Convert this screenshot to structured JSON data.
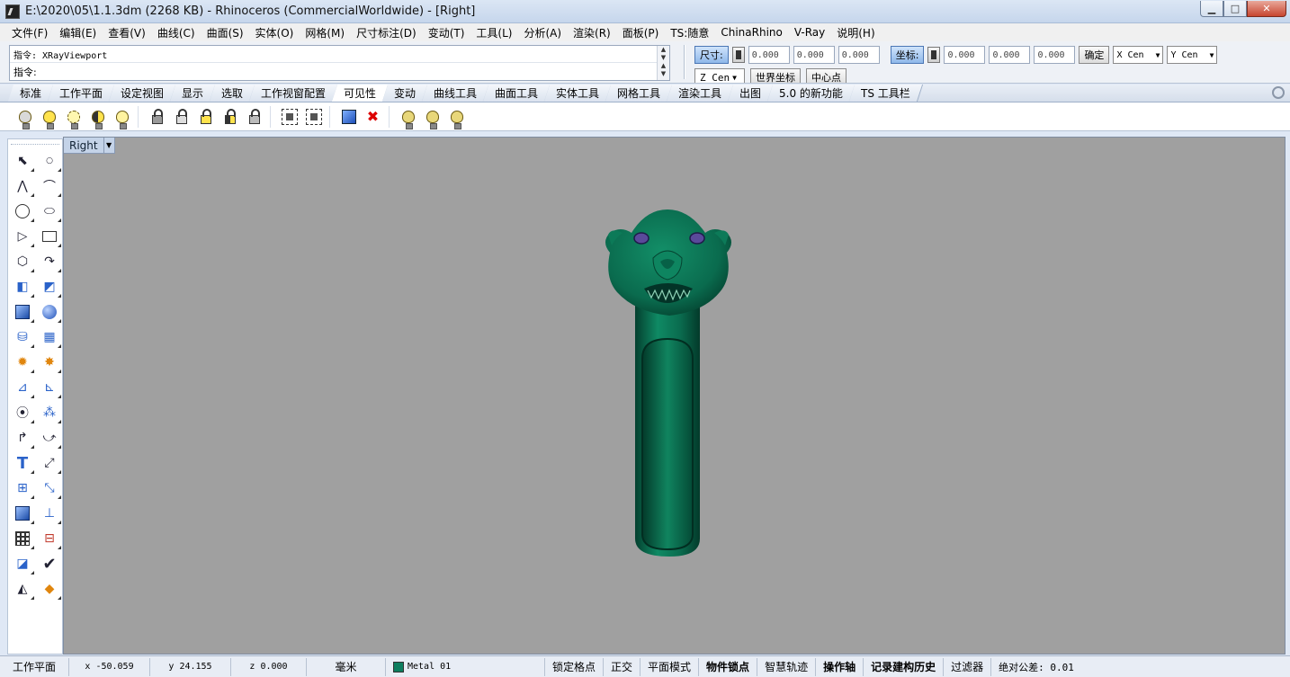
{
  "window": {
    "title": "E:\\2020\\05\\1.1.3dm (2268 KB) - Rhinoceros (CommercialWorldwide) - [Right]",
    "min_label": "▁",
    "max_label": "□",
    "close_label": "✕"
  },
  "menu": {
    "items": [
      "文件(F)",
      "编辑(E)",
      "查看(V)",
      "曲线(C)",
      "曲面(S)",
      "实体(O)",
      "网格(M)",
      "尺寸标注(D)",
      "变动(T)",
      "工具(L)",
      "分析(A)",
      "渲染(R)",
      "面板(P)",
      "TS:随意",
      "ChinaRhino",
      "V-Ray",
      "说明(H)"
    ]
  },
  "command": {
    "history": "指令: XRayViewport",
    "prompt": "指令:"
  },
  "dimensions": {
    "size_label": "尺寸:",
    "size_values": [
      "0.000",
      "0.000",
      "0.000"
    ],
    "coord_label": "坐标:",
    "coord_values": [
      "0.000",
      "0.000",
      "0.000"
    ],
    "confirm_label": "确定",
    "x_select": "X Cen",
    "y_select": "Y Cen",
    "z_select": "Z Cen",
    "world_coords_label": "世界坐标",
    "center_label": "中心点"
  },
  "tabs": {
    "items": [
      "标准",
      "工作平面",
      "设定视图",
      "显示",
      "选取",
      "工作视窗配置",
      "可见性",
      "变动",
      "曲线工具",
      "曲面工具",
      "实体工具",
      "网格工具",
      "渲染工具",
      "出图",
      "5.0 的新功能",
      "TS 工具栏"
    ],
    "active_index": 6
  },
  "viewport": {
    "name": "Right",
    "background": "#a0a0a0",
    "model_color": "#0d7d5e"
  },
  "status": {
    "cplane": "工作平面",
    "x": "x -50.059",
    "y": "y 24.155",
    "z": "z 0.000",
    "units": "毫米",
    "layer": "Metal 01",
    "toggles": [
      "锁定格点",
      "正交",
      "平面模式",
      "物件锁点",
      "智慧轨迹",
      "操作轴",
      "记录建构历史",
      "过滤器"
    ],
    "bold_toggles": [
      "物件锁点",
      "操作轴",
      "记录建构历史"
    ],
    "tolerance": "绝对公差: 0.01"
  }
}
